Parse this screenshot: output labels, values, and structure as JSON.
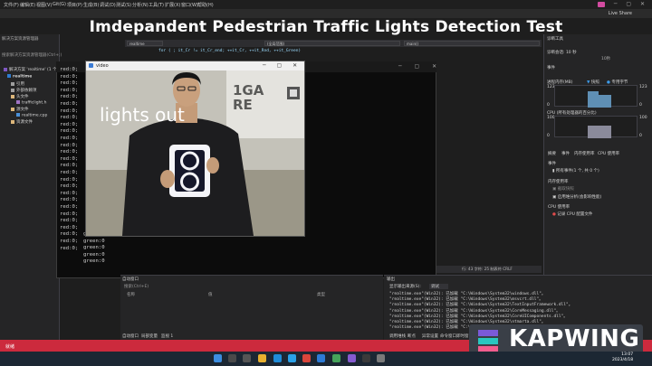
{
  "overlay": {
    "title": "Imdepandent Pedestrian Traffic Lights Detection Test"
  },
  "menubar": {
    "items": [
      "文件(F)",
      "编辑(E)",
      "视图(V)",
      "Git(G)",
      "项目(P)",
      "生成(B)",
      "调试(D)",
      "测试(S)",
      "分析(N)",
      "工具(T)",
      "扩展(X)",
      "窗口(W)",
      "帮助(H)"
    ],
    "live_share": "Live Share"
  },
  "solution_explorer": {
    "header": "解决方案资源管理器",
    "search": "搜索解决方案资源管理器(Ctrl+;)",
    "items": [
      {
        "label": "解决方案 'realtime' (1 个项目，共 1 个)",
        "indent": 0
      },
      {
        "label": "realtime",
        "indent": 1
      },
      {
        "label": "引用",
        "indent": 2
      },
      {
        "label": "外部依赖项",
        "indent": 2
      },
      {
        "label": "头文件",
        "indent": 2
      },
      {
        "label": "trafficlight.h",
        "indent": 3
      },
      {
        "label": "源文件",
        "indent": 2
      },
      {
        "label": "realtime.cpp",
        "indent": 3
      },
      {
        "label": "资源文件",
        "indent": 2
      }
    ]
  },
  "editor": {
    "tab": "realtime",
    "scope_dropdown": "(全局范围)",
    "func_dropdown": "main()",
    "code_line": "for ( ; it_Cr != it_Cr_end; ++it_Cr, ++it_Rnd, ++it_Green)",
    "status": "行: 43    字符: 25    制表符    CRLF"
  },
  "console": {
    "lines": [
      "red:0;",
      "red:0;",
      "red:0;",
      "red:0;",
      "red:0;",
      "red:0;",
      "red:0;",
      "red:0;",
      "red:0;",
      "red:0;",
      "red:0;",
      "red:0;",
      "red:0;",
      "red:0;",
      "red:0;",
      "red:0;",
      "red:0;",
      "red:0;",
      "red:0;",
      "red:0;",
      "red:0;",
      "red:0;",
      "red:0;",
      "red:0;",
      "red:0;",
      "red:0;",
      "red:0;"
    ],
    "green_lines": [
      "green:0",
      "green:0",
      "green:0",
      "green:0",
      "green:0"
    ]
  },
  "video": {
    "title": "video",
    "overlay_text": "lights out"
  },
  "diagnostics": {
    "header": "诊断工具",
    "session": "诊断会话: 10 秒",
    "session_value": "10秒",
    "events": "事件",
    "process_memory": "进程内存(MB)",
    "snapshot": "快照",
    "private_bytes": "专用字节",
    "mem_max": "123",
    "mem_min": "0",
    "cpu": "CPU (所有处理器的百分比)",
    "cpu_max": "100",
    "cpu_min": "0",
    "tabs": [
      "摘要",
      "事件",
      "内存使用率",
      "CPU 使用率"
    ],
    "summary_events": "事件",
    "all_events": "所有事件(1 个, 共 0 个)",
    "memory_usage": "内存使用率",
    "take_snapshot": "截取快照",
    "enable_heap": "启用堆分析(会影响性能)",
    "cpu_usage": "CPU 使用率",
    "record_cpu": "记录 CPU 配置文件"
  },
  "output": {
    "header": "输出",
    "source_label": "显示输出来源(S):",
    "source": "调试",
    "lines": [
      "\"realtime.exe\"(Win32): 已加载 \"C:\\Windows\\System32\\windows.dll\"。",
      "\"realtime.exe\"(Win32): 已加载 \"C:\\Windows\\System32\\msvcrt.dll\"。",
      "\"realtime.exe\"(Win32): 已加载 \"C:\\Windows\\System32\\TextInputFramework.dll\"。",
      "\"realtime.exe\"(Win32): 已加载 \"C:\\Windows\\System32\\CoreMessaging.dll\"。",
      "\"realtime.exe\"(Win32): 已加载 \"C:\\Windows\\System32\\CoreUIComponents.dll\"。",
      "\"realtime.exe\"(Win32): 已加载 \"C:\\Windows\\System32\\ntmarta.dll\"。",
      "\"realtime.exe\"(Win32): 已加载 \"C:\\Windows\\System32\\WinTypes.dll\"。"
    ],
    "tabs": [
      "调用堆栈",
      "断点",
      "异常设置",
      "命令窗口",
      "即时窗口",
      "输出"
    ]
  },
  "errors": {
    "header": "自动窗口",
    "search": "搜索(Ctrl+E)",
    "columns": [
      "名称",
      "值",
      "类型"
    ],
    "tabs": [
      "自动窗口",
      "局部变量",
      "监视 1"
    ]
  },
  "status_bar": {
    "text": "就绪"
  },
  "watermark": {
    "text": "KAPWING"
  },
  "clock": {
    "time": "13:07",
    "date": "2023/4/18"
  },
  "colors": {
    "vs_status": "#cc2a3d",
    "accent": "#007acc"
  }
}
